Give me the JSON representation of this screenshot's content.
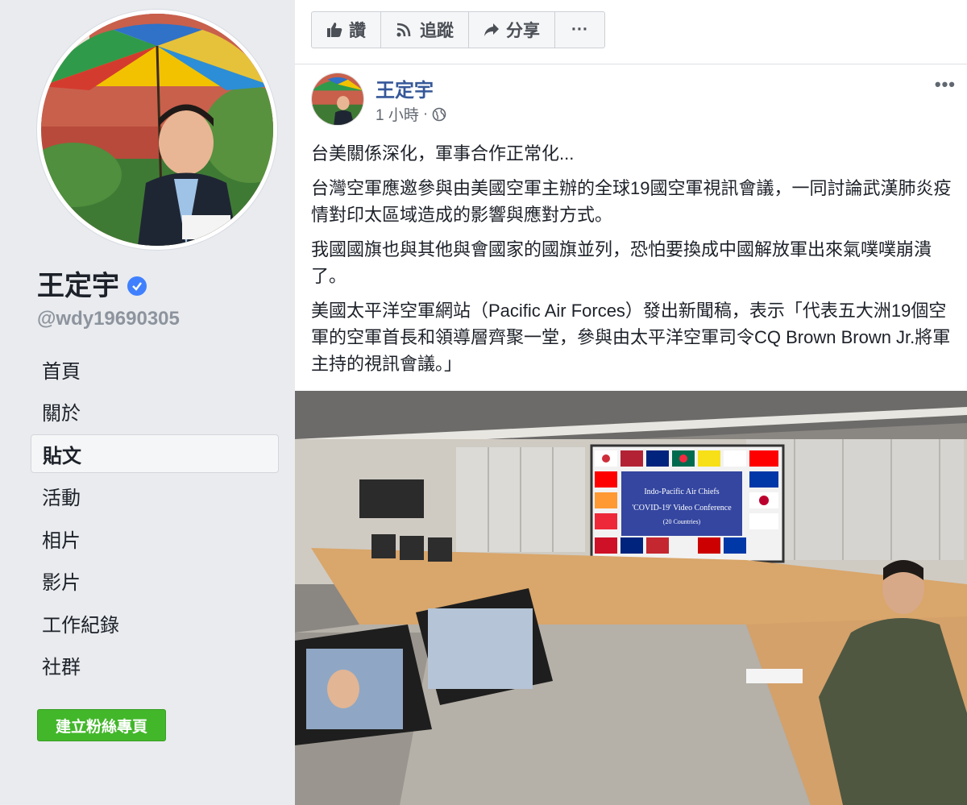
{
  "profile": {
    "name": "王定宇",
    "handle": "@wdy19690305"
  },
  "sidebar": {
    "items": [
      {
        "label": "首頁"
      },
      {
        "label": "關於"
      },
      {
        "label": "貼文",
        "active": true
      },
      {
        "label": "活動"
      },
      {
        "label": "相片"
      },
      {
        "label": "影片"
      },
      {
        "label": "工作紀錄"
      },
      {
        "label": "社群"
      }
    ],
    "create_page_label": "建立粉絲專頁"
  },
  "actionbar": {
    "like_label": "讚",
    "follow_label": "追蹤",
    "share_label": "分享",
    "more_label": "···"
  },
  "post": {
    "author": "王定宇",
    "time": "1 小時",
    "separator": "·",
    "more_label": "•••",
    "paragraphs": [
      "台美關係深化，軍事合作正常化...",
      "台灣空軍應邀參與由美國空軍主辦的全球19國空軍視訊會議，一同討論武漢肺炎疫情對印太區域造成的影響與應對方式。",
      "我國國旗也與其他與會國家的國旗並列，恐怕要換成中國解放軍出來氣噗噗崩潰了。",
      "美國太平洋空軍網站（Pacific Air Forces）發出新聞稿，表示「代表五大洲19個空軍的空軍首長和領導層齊聚一堂，參與由太平洋空軍司令CQ Brown Brown Jr.將軍主持的視訊會議。」"
    ],
    "image": {
      "screen_line1": "Indo-Pacific Air Chiefs",
      "screen_line2": "'COVID-19' Video Conference",
      "screen_line3": "(20 Countries)"
    }
  },
  "colors": {
    "link": "#365899",
    "verified": "#4080ff",
    "create_button": "#42b72a",
    "background": "#e9ebee"
  },
  "icons": [
    "thumbs-up-icon",
    "rss-icon",
    "share-arrow-icon",
    "globe-icon",
    "verified-badge-icon"
  ]
}
